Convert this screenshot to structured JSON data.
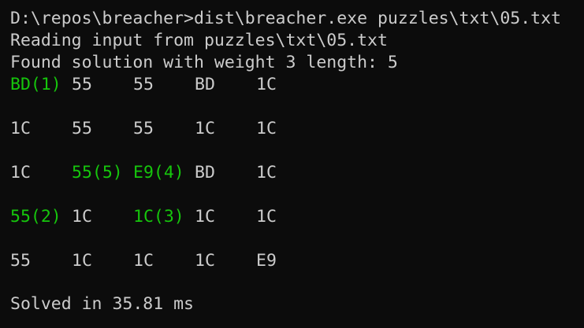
{
  "terminal": {
    "lines": [
      "D:\\repos\\breacher>dist\\breacher.exe puzzles\\txt\\05.txt",
      "Reading input from puzzles\\txt\\05.txt",
      "Found solution with weight 3 length: 5"
    ],
    "grid": [
      [
        {
          "text": "BD(1)",
          "highlight": true
        },
        {
          "text": "55",
          "highlight": false
        },
        {
          "text": "55",
          "highlight": false
        },
        {
          "text": "BD",
          "highlight": false
        },
        {
          "text": "1C",
          "highlight": false
        }
      ],
      [
        {
          "text": "1C",
          "highlight": false
        },
        {
          "text": "55",
          "highlight": false
        },
        {
          "text": "55",
          "highlight": false
        },
        {
          "text": "1C",
          "highlight": false
        },
        {
          "text": "1C",
          "highlight": false
        }
      ],
      [
        {
          "text": "1C",
          "highlight": false
        },
        {
          "text": "55(5)",
          "highlight": true
        },
        {
          "text": "E9(4)",
          "highlight": true
        },
        {
          "text": "BD",
          "highlight": false
        },
        {
          "text": "1C",
          "highlight": false
        }
      ],
      [
        {
          "text": "55(2)",
          "highlight": true
        },
        {
          "text": "1C",
          "highlight": false
        },
        {
          "text": "1C(3)",
          "highlight": true
        },
        {
          "text": "1C",
          "highlight": false
        },
        {
          "text": "1C",
          "highlight": false
        }
      ],
      [
        {
          "text": "55",
          "highlight": false
        },
        {
          "text": "1C",
          "highlight": false
        },
        {
          "text": "1C",
          "highlight": false
        },
        {
          "text": "1C",
          "highlight": false
        },
        {
          "text": "E9",
          "highlight": false
        }
      ]
    ],
    "solved": "Solved in 35.81 ms"
  },
  "colors": {
    "background": "#0c0c0c",
    "text": "#cccccc",
    "highlight": "#16c60c"
  }
}
